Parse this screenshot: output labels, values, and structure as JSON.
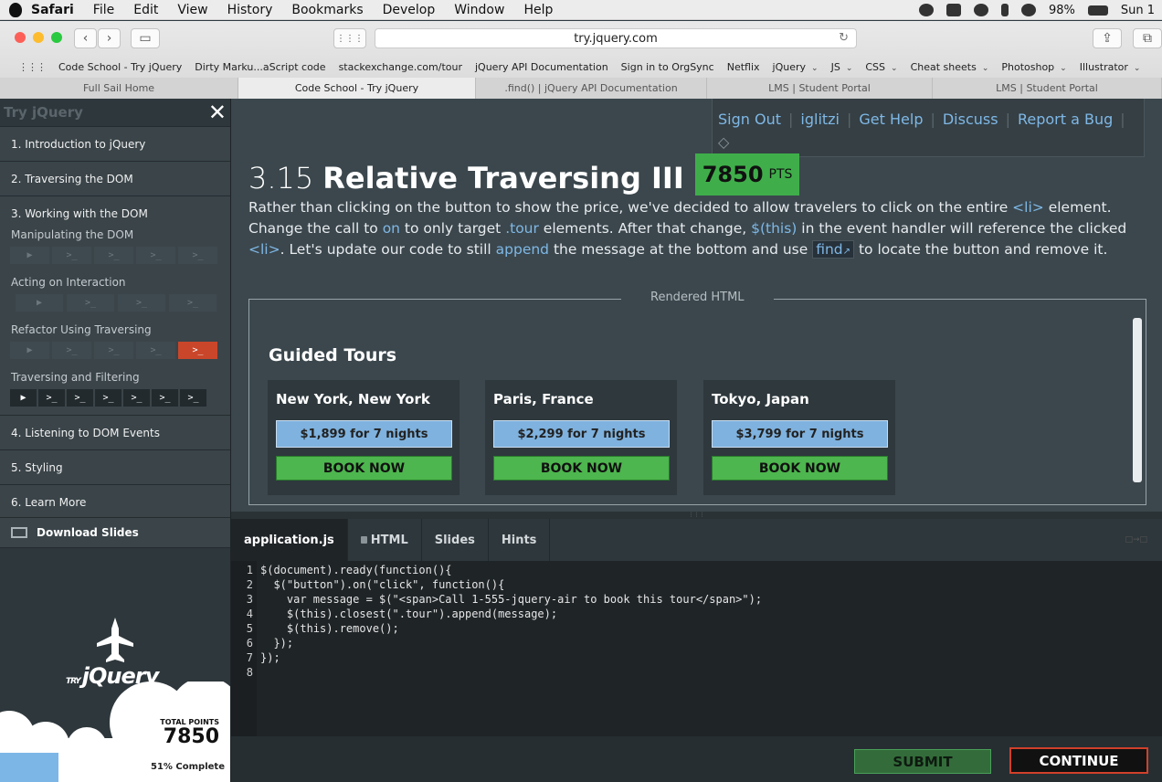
{
  "menubar": {
    "items": [
      "Safari",
      "File",
      "Edit",
      "View",
      "History",
      "Bookmarks",
      "Develop",
      "Window",
      "Help"
    ],
    "battery": "98%",
    "clock": "Sun 1"
  },
  "browser": {
    "url": "try.jquery.com",
    "favorites": [
      {
        "label": "Code School - Try jQuery",
        "menu": false
      },
      {
        "label": "Dirty Marku...aScript code",
        "menu": false
      },
      {
        "label": "stackexchange.com/tour",
        "menu": false
      },
      {
        "label": "jQuery API Documentation",
        "menu": false
      },
      {
        "label": "Sign in to OrgSync",
        "menu": false
      },
      {
        "label": "Netflix",
        "menu": false
      },
      {
        "label": "jQuery",
        "menu": true
      },
      {
        "label": "JS",
        "menu": true
      },
      {
        "label": "CSS",
        "menu": true
      },
      {
        "label": "Cheat sheets",
        "menu": true
      },
      {
        "label": "Photoshop",
        "menu": true
      },
      {
        "label": "Illustrator",
        "menu": true
      }
    ],
    "tabs": [
      "Full Sail Home",
      "Code School - Try jQuery",
      ".find() | jQuery API Documentation",
      "LMS | Student Portal",
      "LMS | Student Portal"
    ]
  },
  "sidebar": {
    "title": "Try jQuery",
    "close_icon": "close-icon",
    "levels": [
      "1. Introduction to jQuery",
      "2. Traversing the DOM",
      "3. Working with the DOM",
      "4. Listening to DOM Events",
      "5. Styling",
      "6. Learn More"
    ],
    "sections": [
      {
        "title": "Manipulating the DOM",
        "challenges": [
          "▶",
          ">_",
          ">_",
          ">_",
          ">_"
        ]
      },
      {
        "title": "Acting on Interaction",
        "challenges": [
          "▶",
          ">_",
          ">_",
          ">_"
        ]
      },
      {
        "title": "Refactor Using Traversing",
        "challenges": [
          "▶",
          ">_",
          ">_",
          ">_",
          ">_"
        ]
      },
      {
        "title": "Traversing and Filtering",
        "challenges": [
          "▶",
          ">_",
          ">_",
          ">_",
          ">_",
          ">_",
          ">_"
        ]
      }
    ],
    "download_label": "Download Slides",
    "logo_try": "TRY",
    "logo_name": "jQuery",
    "total_points_label": "TOTAL POINTS",
    "total_points": "7850",
    "progress_percent": 51,
    "progress_label": "51% Complete"
  },
  "topnav": {
    "sign_out": "Sign Out",
    "user": "iglitzi",
    "get_help": "Get Help",
    "discuss": "Discuss",
    "report": "Report a Bug"
  },
  "challenge": {
    "number": "3.15",
    "title": "Relative Traversing III",
    "points": "7850",
    "points_unit": "PTS",
    "instr": {
      "t1": "Rather than clicking on the button to show the price, we've decided to allow travelers to click on the entire ",
      "k1": "<li>",
      "t2": " element. Change the call to ",
      "k2": "on",
      "t3": " to only target ",
      "k3": ".tour",
      "t4": " elements. After that change, ",
      "k4": "$(this)",
      "t5": " in the event handler will reference the clicked ",
      "k5": "<li>",
      "t6": ". Let's update our code to still ",
      "k6": "append",
      "t7": " the message at the bottom and use ",
      "k7": "find",
      "t8": " to locate the button and remove it."
    }
  },
  "rendered": {
    "caption": "Rendered HTML",
    "heading": "Guided Tours",
    "tours": [
      {
        "city": "New York, New York",
        "price": "$1,899 for 7 nights",
        "book": "BOOK NOW"
      },
      {
        "city": "Paris, France",
        "price": "$2,299 for 7 nights",
        "book": "BOOK NOW"
      },
      {
        "city": "Tokyo, Japan",
        "price": "$3,799 for 7 nights",
        "book": "BOOK NOW"
      }
    ]
  },
  "editor": {
    "tabs": [
      "application.js",
      "HTML",
      "Slides",
      "Hints"
    ],
    "lines": [
      "$(document).ready(function(){",
      "  $(\"button\").on(\"click\", function(){",
      "    var message = $(\"<span>Call 1-555-jquery-air to book this tour</span>\");",
      "    $(this).closest(\".tour\").append(message);",
      "    $(this).remove();",
      "  });",
      "});",
      ""
    ]
  },
  "footer": {
    "submit": "SUBMIT",
    "continue": "CONTINUE"
  }
}
